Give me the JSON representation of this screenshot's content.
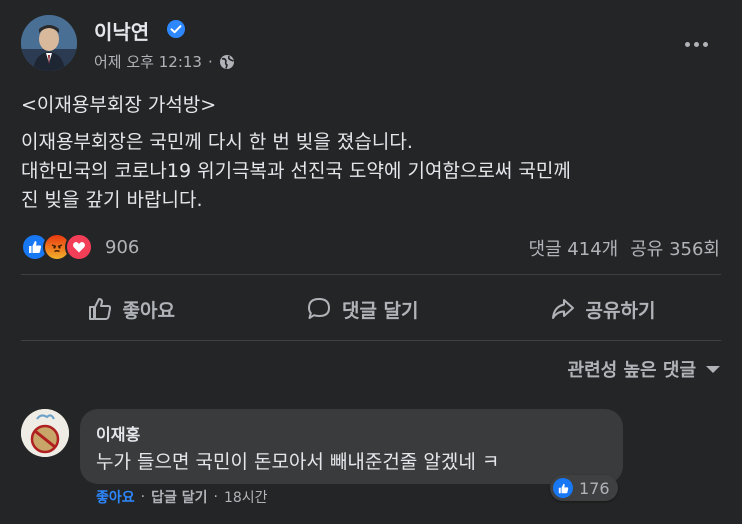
{
  "post": {
    "author": "이낙연",
    "time": "어제 오후 12:13",
    "dot": "·",
    "title": "<이재용부회장 가석방>",
    "body_lines": [
      "이재용부회장은 국민께 다시 한 번 빚을 졌습니다.",
      "대한민국의 코로나19 위기극복과 선진국 도약에 기여함으로써 국민께",
      "진 빚을 갚기 바랍니다."
    ],
    "reaction_count": "906",
    "comments_count": "댓글 414개",
    "shares_count": "공유 356회",
    "icons": {
      "verified": "verified-badge-icon",
      "privacy": "globe-icon",
      "more": "more-options-icon"
    }
  },
  "actions": {
    "like": "좋아요",
    "comment": "댓글 달기",
    "share": "공유하기"
  },
  "sort": {
    "label": "관련성 높은 댓글"
  },
  "comment": {
    "author": "이재홍",
    "text": "누가 들으면 국민이 돈모아서 빼내준건줄 알겠네 ㅋ",
    "like_label": "좋아요",
    "dot1": "·",
    "reply_label": "답글 달기",
    "dot2": "·",
    "time": "18시간",
    "like_count": "176"
  },
  "colors": {
    "background": "#242526",
    "text": "#e4e6eb",
    "secondary": "#b0b3b8",
    "accent": "#2d88ff",
    "like_blue": "#1877f2",
    "love_red": "#f33e58",
    "angry_orange": "#e9710f"
  }
}
